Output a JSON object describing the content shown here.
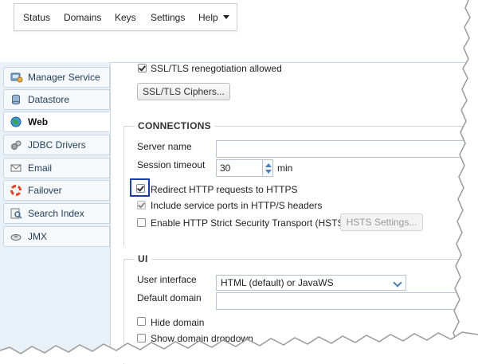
{
  "menu": {
    "items": [
      "Status",
      "Domains",
      "Keys",
      "Settings",
      "Help"
    ]
  },
  "sidebar": {
    "items": [
      {
        "label": "Manager Service",
        "icon": "manager-service-icon",
        "active": false
      },
      {
        "label": "Datastore",
        "icon": "datastore-icon",
        "active": false
      },
      {
        "label": "Web",
        "icon": "web-globe-icon",
        "active": true
      },
      {
        "label": "JDBC Drivers",
        "icon": "jdbc-drivers-icon",
        "active": false
      },
      {
        "label": "Email",
        "icon": "email-icon",
        "active": false
      },
      {
        "label": "Failover",
        "icon": "failover-icon",
        "active": false
      },
      {
        "label": "Search Index",
        "icon": "search-index-icon",
        "active": false
      },
      {
        "label": "JMX",
        "icon": "jmx-icon",
        "active": false
      }
    ]
  },
  "ssl": {
    "renegotiation_label": "SSL/TLS renegotiation allowed",
    "renegotiation_checked": true,
    "ciphers_button": "SSL/TLS Ciphers..."
  },
  "connections": {
    "title": "CONNECTIONS",
    "server_name_label": "Server name",
    "server_name_value": "",
    "session_timeout_label": "Session timeout",
    "session_timeout_value": "30",
    "session_timeout_unit": "min",
    "redirect_label": "Redirect HTTP requests to HTTPS",
    "redirect_checked": true,
    "include_ports_label": "Include service ports in HTTP/S headers",
    "include_ports_checked": true,
    "hsts_label": "Enable HTTP Strict Security Transport (HSTS)",
    "hsts_checked": false,
    "hsts_button": "HSTS Settings..."
  },
  "ui": {
    "title": "UI",
    "user_interface_label": "User interface",
    "user_interface_value": "HTML (default) or JavaWS",
    "default_domain_label": "Default domain",
    "default_domain_value": "",
    "hide_domain_label": "Hide domain",
    "hide_domain_checked": false,
    "show_dropdown_label": "Show domain dropdown",
    "show_dropdown_checked": false
  },
  "colors": {
    "sidebar_bg": "#e8f0f8",
    "highlight_border": "#1b3fa8",
    "accent": "#4a7fb5"
  }
}
